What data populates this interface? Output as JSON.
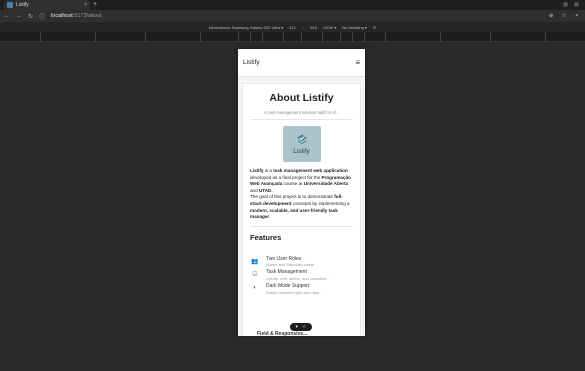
{
  "browser": {
    "tab_title": "Listify",
    "tab_close": "×",
    "new_tab": "+",
    "url_host": "localhost",
    "url_path": ":5173/about",
    "nav_back": "←",
    "nav_forward": "→",
    "nav_reload": "↻",
    "site_info": "ⓘ",
    "right_icons": [
      "⊕",
      "☆",
      "⚬"
    ]
  },
  "devtools": {
    "dimensions": "Dimensions: Samsung Galaxy S20 Ultra ▾",
    "width": "412",
    "times": "×",
    "height": "915",
    "zoom": "100% ▾",
    "throttle": "No throttling ▾",
    "rotate": "⟳"
  },
  "app": {
    "brand": "Listify",
    "menu_icon": "≡",
    "about_title": "About Listify",
    "subtitle": "A task management solution built for ef...",
    "logo_text": "Listify",
    "desc": {
      "p1": "Listify",
      "p2": " is a ",
      "p3": "task management web application",
      "p4": " developed as a final project for the ",
      "p5": "Programação Web Avançada",
      "p6": " course at ",
      "p7": "Universidade Aberta",
      "p8": " and ",
      "p9": "UTAD",
      "p10": ".",
      "p11": "The goal of this project is to demonstrate ",
      "p12": "full-stack development",
      "p13": " concepts by implementing a ",
      "p14": "modern, scalable, and user-friendly task manager",
      "p15": "."
    },
    "features_title": "Features",
    "features": [
      {
        "icon": "👥",
        "title": "Two User Roles",
        "desc": "Admin and Standard Users"
      },
      {
        "icon": "☑",
        "title": "Task Management",
        "desc": "Create, edit, delete, and complete..."
      },
      {
        "icon": "◐",
        "title": "Dark Mode Support",
        "desc": "Switch between light and dark..."
      }
    ],
    "peek_text": "Field & Responsive...",
    "pill_icons": [
      "▾",
      "☆"
    ]
  }
}
